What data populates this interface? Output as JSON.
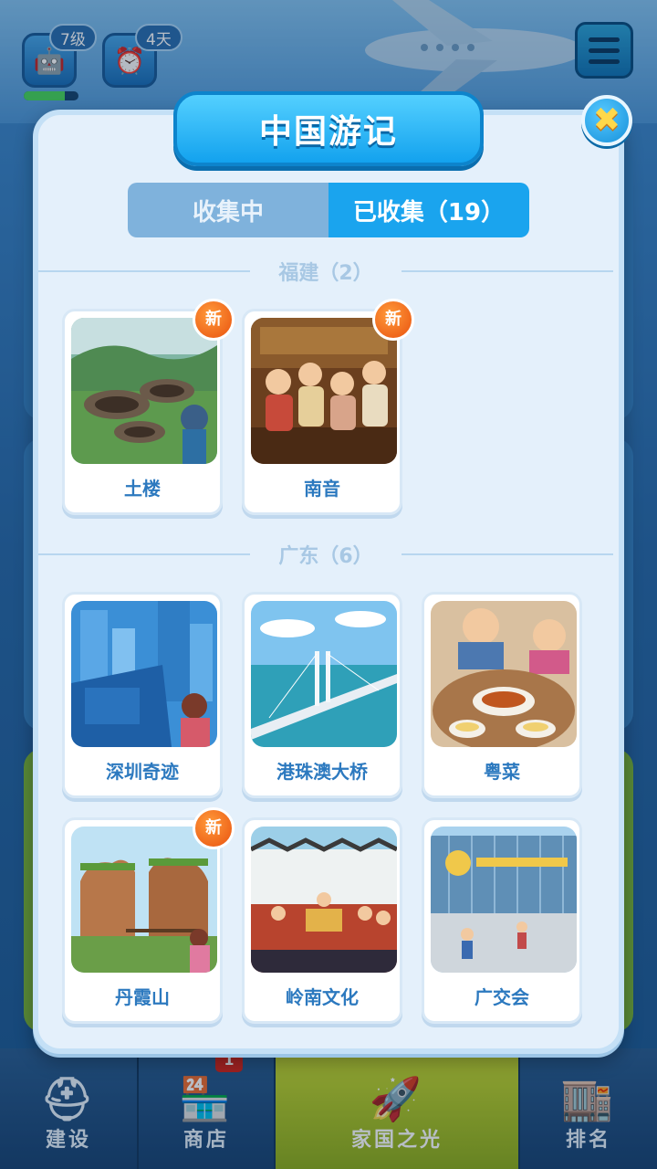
{
  "hud": {
    "level": "7级",
    "days": "4天",
    "xp_progress": 0.75
  },
  "dialog": {
    "title": "中国游记",
    "close_symbol": "✖",
    "tabs": [
      {
        "label": "收集中",
        "active": false
      },
      {
        "label": "已收集（19）",
        "active": true
      }
    ],
    "new_badge": "新",
    "sections": [
      {
        "label": "福建（2）",
        "items": [
          {
            "name": "土楼",
            "is_new": true,
            "image": "tulou-illustration"
          },
          {
            "name": "南音",
            "is_new": true,
            "image": "nanyin-musicians-illustration"
          }
        ]
      },
      {
        "label": "广东（6）",
        "items": [
          {
            "name": "深圳奇迹",
            "is_new": false,
            "image": "shenzhen-skyline-illustration"
          },
          {
            "name": "港珠澳大桥",
            "is_new": false,
            "image": "hzmb-bridge-illustration"
          },
          {
            "name": "粤菜",
            "is_new": false,
            "image": "cantonese-food-illustration"
          },
          {
            "name": "丹霞山",
            "is_new": true,
            "image": "danxia-mountain-illustration"
          },
          {
            "name": "岭南文化",
            "is_new": false,
            "image": "lingnan-opera-illustration"
          },
          {
            "name": "广交会",
            "is_new": false,
            "image": "canton-fair-illustration"
          }
        ]
      }
    ]
  },
  "bottom_nav": [
    {
      "label": "建设",
      "icon": "hard-hat-icon",
      "active": false
    },
    {
      "label": "商店",
      "icon": "shop-icon",
      "active": false,
      "badge": "1"
    },
    {
      "label": "家国之光",
      "icon": "rocket-icon",
      "active": true
    },
    {
      "label": "排名",
      "icon": "ranking-building-icon",
      "active": false
    }
  ],
  "colors": {
    "accent": "#1aa4ee",
    "card_text": "#2c79bf",
    "new_badge": "#e9520f",
    "active_nav": "#b3c92a"
  }
}
